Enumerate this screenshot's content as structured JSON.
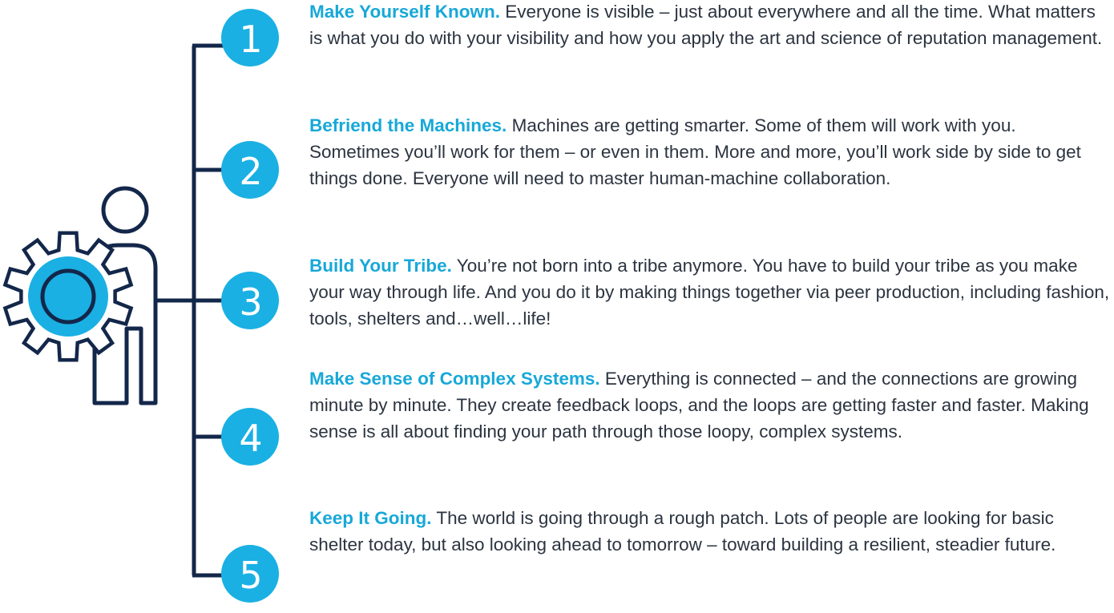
{
  "colors": {
    "accent": "#1ab0e3",
    "navy": "#13274a",
    "title": "#17a8d8",
    "body": "#2b3440"
  },
  "icons": [
    "person-outline-icon",
    "gear-icon"
  ],
  "items": [
    {
      "num": "1",
      "title": "Make Yourself Known.",
      "text": "Everyone is visible – just about everywhere and all the time. What matters is what you do with your visibility and how you apply the art and science of reputation management."
    },
    {
      "num": "2",
      "title": "Befriend the Machines.",
      "text": "Machines are getting smarter. Some of them will work with you. Sometimes you’ll work for them – or even in them. More and more, you’ll work side by side to get things done. Everyone will need to master human-machine collaboration."
    },
    {
      "num": "3",
      "title": "Build Your Tribe.",
      "text": "You’re not born into a tribe anymore. You have to build your tribe as you make your way through life. And you do it by making things together via peer production, including fashion, tools, shelters and…well…life!"
    },
    {
      "num": "4",
      "title": "Make Sense of Complex Systems.",
      "text": "Everything is connected – and the connections are growing minute by minute. They create feedback loops, and the loops are getting faster and faster. Making sense is all about finding your path through those loopy, complex systems."
    },
    {
      "num": "5",
      "title": "Keep It Going.",
      "text": "The world is going through a rough patch. Lots of people are looking for basic shelter today, but also looking ahead to tomorrow – toward building a resilient, steadier future."
    }
  ]
}
